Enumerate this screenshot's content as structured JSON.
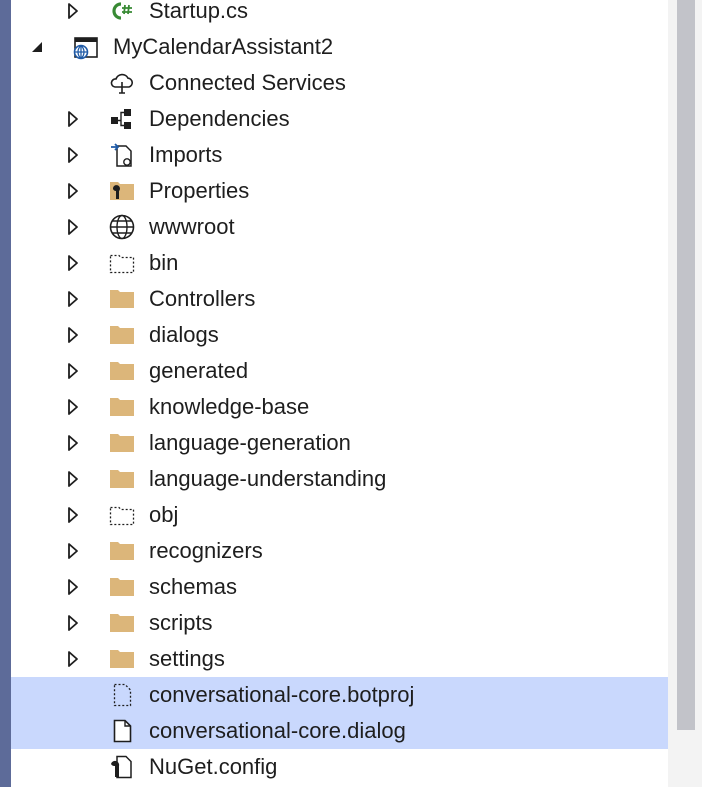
{
  "tree": {
    "startup": {
      "label": "Startup.cs",
      "icon": "csharp-file-icon"
    },
    "project": {
      "label": "MyCalendarAssistant2",
      "icon": "web-project-icon"
    },
    "connected_services": {
      "label": "Connected Services",
      "icon": "connected-services-icon"
    },
    "dependencies": {
      "label": "Dependencies",
      "icon": "dependencies-icon"
    },
    "imports": {
      "label": "Imports",
      "icon": "imports-icon"
    },
    "properties": {
      "label": "Properties",
      "icon": "properties-folder-icon"
    },
    "wwwroot": {
      "label": "wwwroot",
      "icon": "globe-icon"
    },
    "bin": {
      "label": "bin",
      "icon": "excluded-folder-icon"
    },
    "controllers": {
      "label": "Controllers",
      "icon": "folder-icon"
    },
    "dialogs": {
      "label": "dialogs",
      "icon": "folder-icon"
    },
    "generated": {
      "label": "generated",
      "icon": "folder-icon"
    },
    "knowledge_base": {
      "label": "knowledge-base",
      "icon": "folder-icon"
    },
    "language_generation": {
      "label": "language-generation",
      "icon": "folder-icon"
    },
    "language_understanding": {
      "label": "language-understanding",
      "icon": "folder-icon"
    },
    "obj": {
      "label": "obj",
      "icon": "excluded-folder-icon"
    },
    "recognizers": {
      "label": "recognizers",
      "icon": "folder-icon"
    },
    "schemas": {
      "label": "schemas",
      "icon": "folder-icon"
    },
    "scripts": {
      "label": "scripts",
      "icon": "folder-icon"
    },
    "settings": {
      "label": "settings",
      "icon": "folder-icon"
    },
    "botproj": {
      "label": "conversational-core.botproj",
      "icon": "excluded-file-icon"
    },
    "dialog_file": {
      "label": "conversational-core.dialog",
      "icon": "file-icon"
    },
    "nuget": {
      "label": "NuGet.config",
      "icon": "config-file-icon"
    }
  },
  "colors": {
    "selection": "#c9d8fd",
    "folder": "#dcb67a",
    "left_accent": "#5d6b99",
    "scrollbar_thumb": "#c2c3c9",
    "csharp": "#388a34"
  }
}
